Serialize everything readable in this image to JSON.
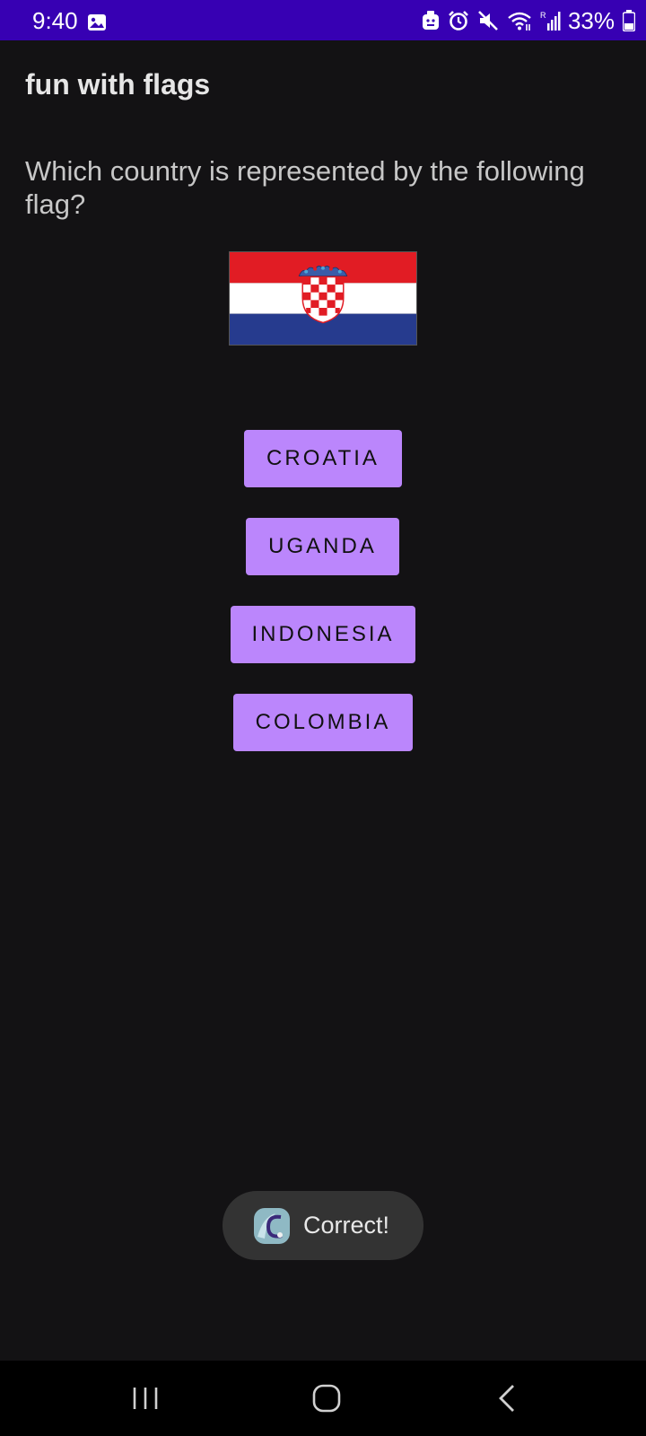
{
  "status_bar": {
    "time": "9:40",
    "battery": "33%",
    "icons": [
      "photo-icon",
      "android-debug-icon",
      "alarm-icon",
      "mute-icon",
      "wifi-icon",
      "signal-icon",
      "battery-icon"
    ],
    "background": "#3700b3"
  },
  "app": {
    "title": "fun with flags"
  },
  "quiz": {
    "question": "Which country is represented by the following flag?",
    "flag": "croatia-flag",
    "answers": [
      {
        "label": "CROATIA"
      },
      {
        "label": "UGANDA"
      },
      {
        "label": "INDONESIA"
      },
      {
        "label": "COLOMBIA"
      }
    ],
    "button_color": "#bb86fc"
  },
  "toast": {
    "message": "Correct!",
    "icon": "app-icon"
  },
  "nav_bar": {
    "buttons": [
      "recent-apps",
      "home",
      "back"
    ]
  }
}
